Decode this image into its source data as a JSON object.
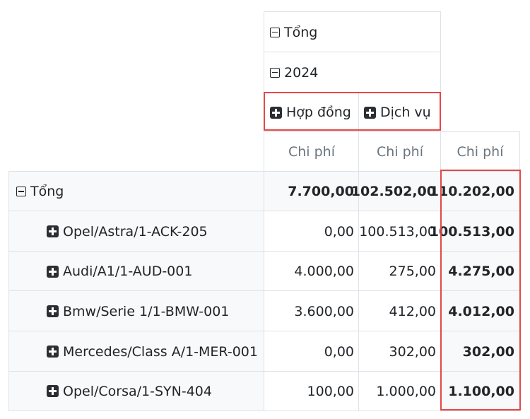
{
  "col_header": {
    "total_label": "Tổng",
    "year_label": "2024",
    "groups": [
      "Hợp đồng",
      "Dịch vụ"
    ],
    "measure": "Chi phí"
  },
  "row_header": {
    "total_label": "Tổng"
  },
  "totals": [
    "7.700,00",
    "102.502,00",
    "110.202,00"
  ],
  "rows": [
    {
      "label": "Opel/Astra/1-ACK-205",
      "values": [
        "0,00",
        "100.513,00",
        "100.513,00"
      ]
    },
    {
      "label": "Audi/A1/1-AUD-001",
      "values": [
        "4.000,00",
        "275,00",
        "4.275,00"
      ]
    },
    {
      "label": "Bmw/Serie 1/1-BMW-001",
      "values": [
        "3.600,00",
        "412,00",
        "4.012,00"
      ]
    },
    {
      "label": "Mercedes/Class A/1-MER-001",
      "values": [
        "0,00",
        "302,00",
        "302,00"
      ]
    },
    {
      "label": "Opel/Corsa/1-SYN-404",
      "values": [
        "100,00",
        "1.000,00",
        "1.100,00"
      ]
    }
  ],
  "colors": {
    "highlight": "#e54747",
    "header_bg": "#f8f9fa",
    "border": "#dee2e6"
  }
}
